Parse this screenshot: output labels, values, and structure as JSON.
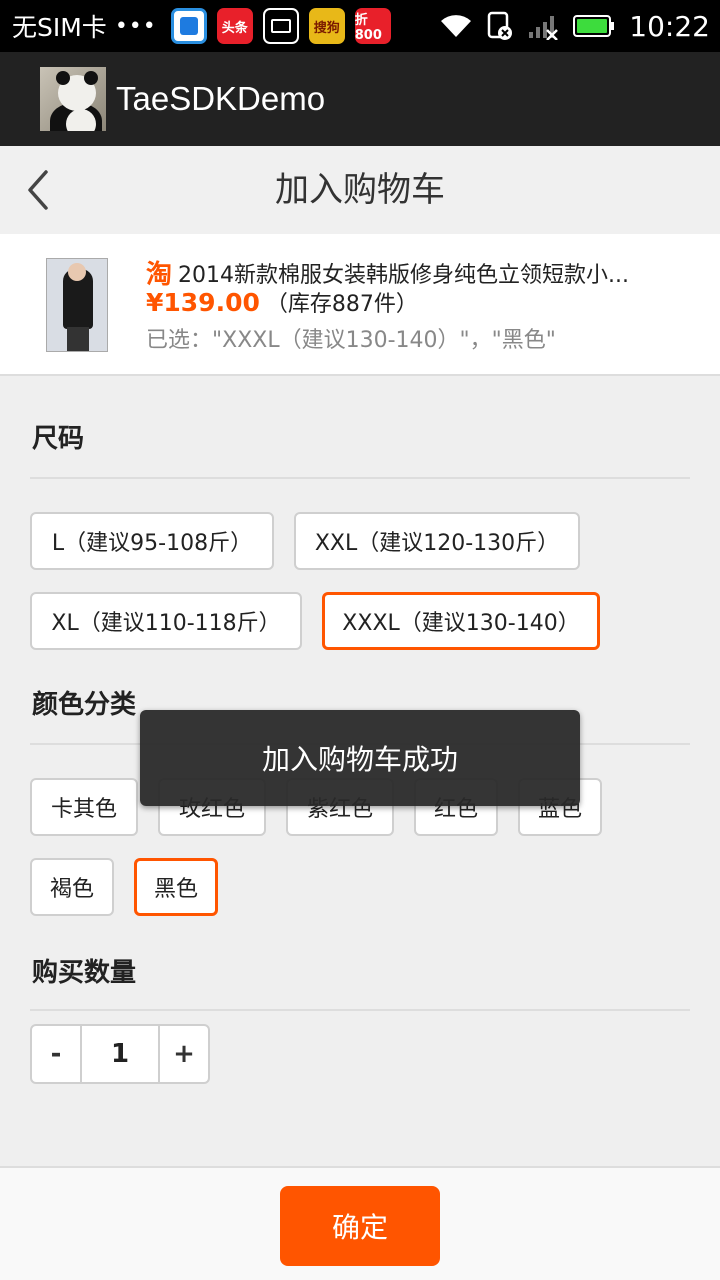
{
  "status_bar": {
    "carrier": "无SIM卡",
    "dots": "•••",
    "apps": [
      {
        "icon": "baidu-map-icon",
        "label": ""
      },
      {
        "icon": "toutiao-icon",
        "label": "头条"
      },
      {
        "icon": "gallery-icon",
        "label": ""
      },
      {
        "icon": "sogou-icon",
        "label": "搜狗"
      },
      {
        "icon": "zhe800-icon",
        "label": "折800"
      }
    ],
    "time": "10:22"
  },
  "action_bar": {
    "title": "TaeSDKDemo"
  },
  "nav": {
    "title": "加入购物车"
  },
  "product": {
    "taobao_icon": "淘",
    "title": "2014新款棉服女装韩版修身纯色立领短款小...",
    "price": "¥139.00",
    "stock": "（库存887件）",
    "selected": "已选：\"XXXL（建议130-140）\"，\"黑色\""
  },
  "size": {
    "title": "尺码",
    "options": [
      {
        "label": "L（建议95-108斤）",
        "selected": false
      },
      {
        "label": "XXL（建议120-130斤）",
        "selected": false
      },
      {
        "label": "XL（建议110-118斤）",
        "selected": false
      },
      {
        "label": "XXXL（建议130-140）",
        "selected": true
      }
    ]
  },
  "color": {
    "title": "颜色分类",
    "options": [
      {
        "label": "卡其色",
        "selected": false
      },
      {
        "label": "玫红色",
        "selected": false
      },
      {
        "label": "紫红色",
        "selected": false
      },
      {
        "label": "红色",
        "selected": false
      },
      {
        "label": "蓝色",
        "selected": false
      },
      {
        "label": "褐色",
        "selected": false
      },
      {
        "label": "黑色",
        "selected": true
      }
    ]
  },
  "quantity": {
    "title": "购买数量",
    "minus": "-",
    "value": "1",
    "plus": "+"
  },
  "confirm_label": "确定",
  "toast": "加入购物车成功",
  "colors": {
    "accent": "#ff5500",
    "action_bar": "#222222",
    "background": "#efefef"
  }
}
